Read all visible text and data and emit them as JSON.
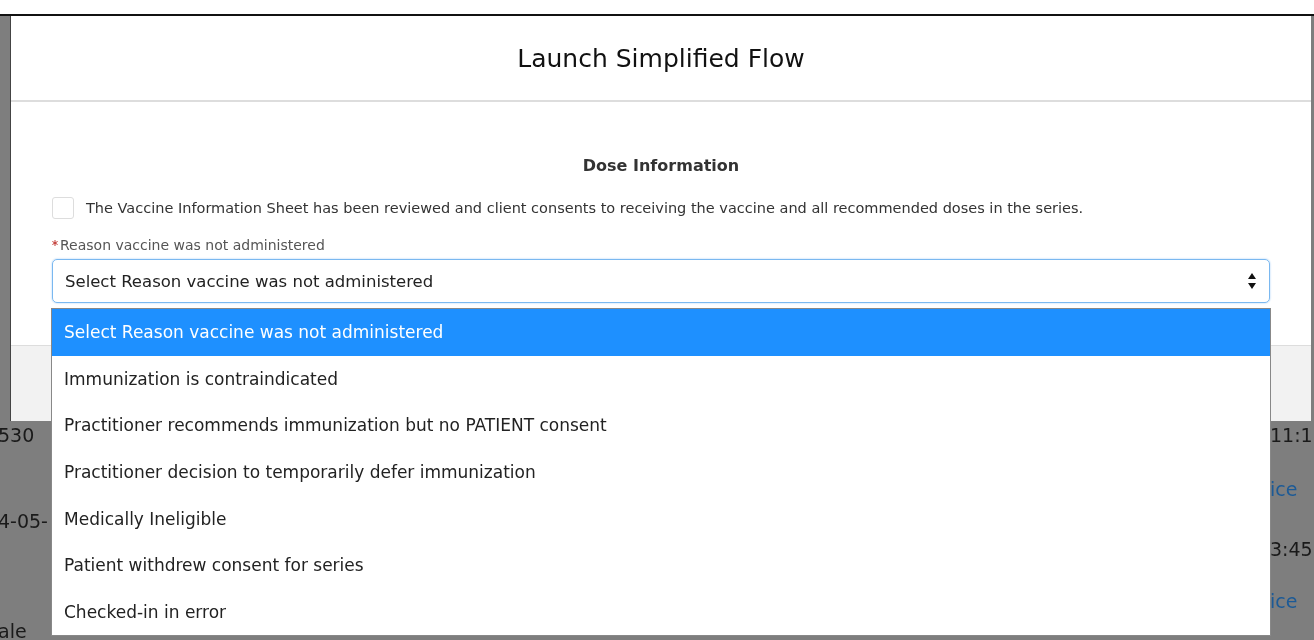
{
  "modal": {
    "title": "Launch Simplified Flow",
    "section_title": "Dose Information",
    "consent_checkbox": {
      "label": "The Vaccine Information Sheet has been reviewed and client consents to receiving the vaccine and all recommended doses in the series.",
      "checked": false
    },
    "reason_field": {
      "label": "Reason vaccine was not administered",
      "required": true,
      "value": "Select Reason vaccine was not administered",
      "expanded": true,
      "options": [
        {
          "label": "Select Reason vaccine was not administered",
          "selected": true
        },
        {
          "label": "Immunization is contraindicated",
          "selected": false
        },
        {
          "label": "Practitioner recommends immunization but no PATIENT consent",
          "selected": false
        },
        {
          "label": "Practitioner decision to temporarily defer immunization",
          "selected": false
        },
        {
          "label": "Medically Ineligible",
          "selected": false
        },
        {
          "label": "Patient withdrew consent for series",
          "selected": false
        },
        {
          "label": "Checked-in in error",
          "selected": false
        }
      ]
    }
  },
  "background": {
    "left": [
      {
        "text": "530",
        "kind": "text"
      },
      {
        "text": "4-05-",
        "kind": "text"
      },
      {
        "text": "ale",
        "kind": "text"
      }
    ],
    "right": [
      {
        "text": "11:1",
        "kind": "text"
      },
      {
        "text": "ice",
        "kind": "link"
      },
      {
        "text": "3:45",
        "kind": "text"
      },
      {
        "text": "ice",
        "kind": "link"
      }
    ]
  }
}
